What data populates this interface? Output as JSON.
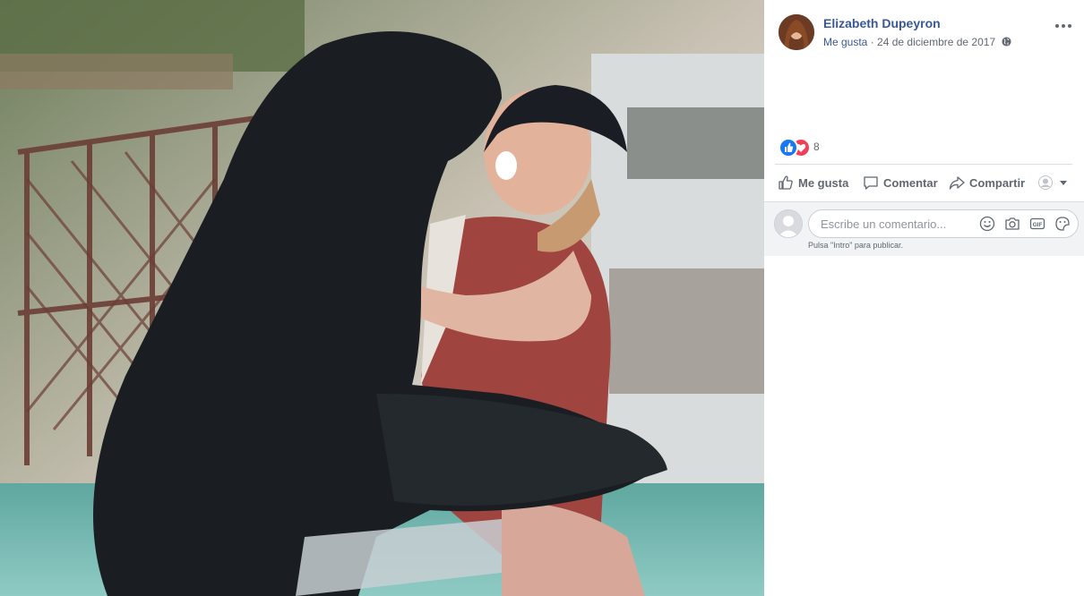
{
  "photo": {
    "description_icon": "sea-lion-hug-photo"
  },
  "post": {
    "author": "Elizabeth Dupeyron",
    "like_link": "Me gusta",
    "separator": " · ",
    "date": "24 de diciembre de 2017",
    "privacy_icon": "globe-icon",
    "more_icon": "more-dots-icon"
  },
  "reactions": {
    "icons": [
      "like-reaction-icon",
      "love-reaction-icon"
    ],
    "count": "8"
  },
  "actions": {
    "like": "Me gusta",
    "comment": "Comentar",
    "share": "Compartir"
  },
  "comment_box": {
    "placeholder": "Escribe un comentario...",
    "hint": "Pulsa \"Intro\" para publicar.",
    "icons": [
      "emoji-icon",
      "camera-icon",
      "gif-icon",
      "sticker-icon"
    ]
  },
  "colors": {
    "link": "#385898",
    "meta": "#606770",
    "like_reaction": "#1877f2",
    "love_reaction": "#f33e58",
    "comment_bg": "#f2f3f5"
  }
}
